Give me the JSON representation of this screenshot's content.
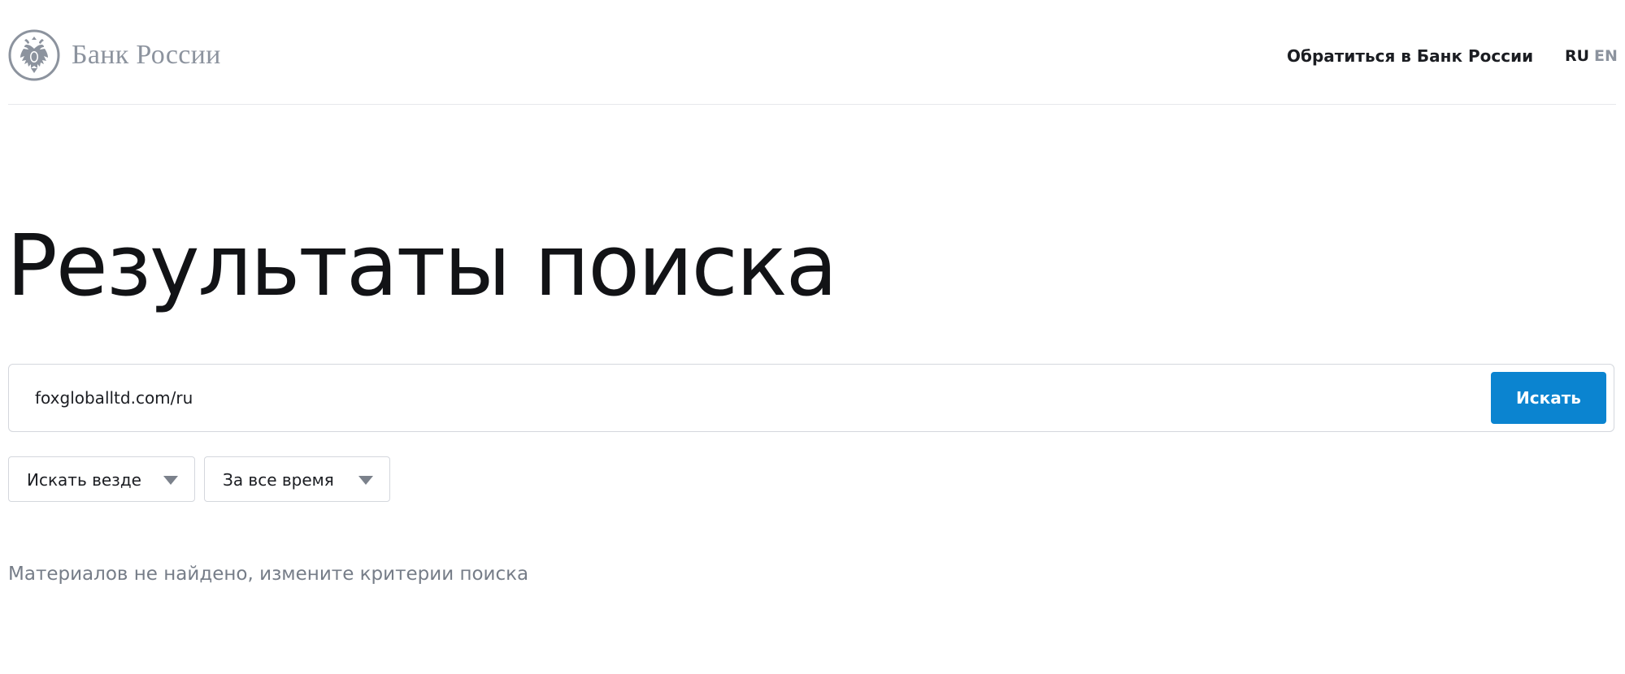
{
  "header": {
    "logo_text": "Банк России",
    "contact_link": "Обратиться в Банк России",
    "languages": [
      {
        "label": "RU",
        "active": true
      },
      {
        "label": "EN",
        "active": false
      }
    ]
  },
  "main": {
    "title": "Результаты поиска",
    "search": {
      "value": "foxgloballtd.com/ru",
      "button_label": "Искать"
    },
    "filters": [
      {
        "label": "Искать везде",
        "icon": "triangle-down-icon"
      },
      {
        "label": "За все время",
        "icon": "triangle-down-icon"
      }
    ],
    "empty_message": "Материалов не найдено, измените критерии поиска"
  },
  "colors": {
    "accent": "#0b84d0",
    "logo_gray": "#8c939e",
    "muted_text": "#767d88",
    "border": "#d4d7dd"
  }
}
